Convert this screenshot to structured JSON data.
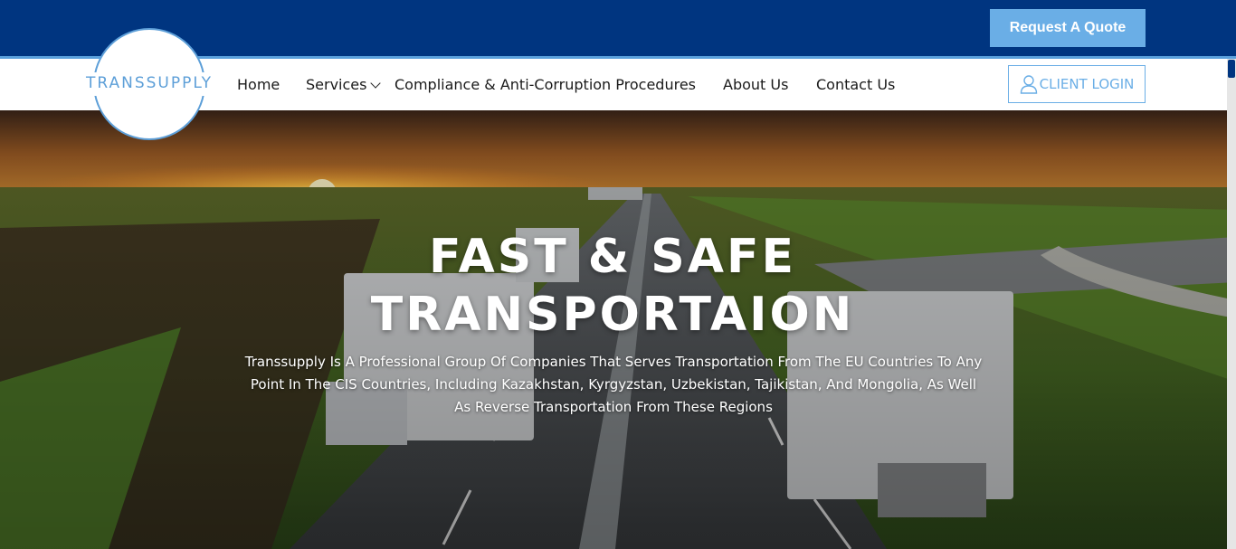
{
  "header": {
    "quote_label": "Request A Quote",
    "login_label": "CLIENT LOGIN"
  },
  "logo": {
    "text": "TRANSSUPPLY"
  },
  "nav": {
    "items": [
      {
        "label": "Home"
      },
      {
        "label": "Services"
      },
      {
        "label": "Compliance & Anti-Corruption Procedures"
      },
      {
        "label": "About Us"
      },
      {
        "label": "Contact Us"
      }
    ]
  },
  "hero": {
    "title_line1": "FAST & SAFE",
    "title_line2": "TRANSPORTAION",
    "description": "Transsupply Is A Professional Group Of Companies That Serves Transportation From The EU Countries To Any Point In The CIS Countries, Including Kazakhstan, Kyrgyzstan, Uzbekistan, Tajikistan, And Mongolia, As Well As Reverse Transportation From These Regions"
  },
  "colors": {
    "brand_dark": "#003580",
    "brand_light": "#6aaee6"
  }
}
